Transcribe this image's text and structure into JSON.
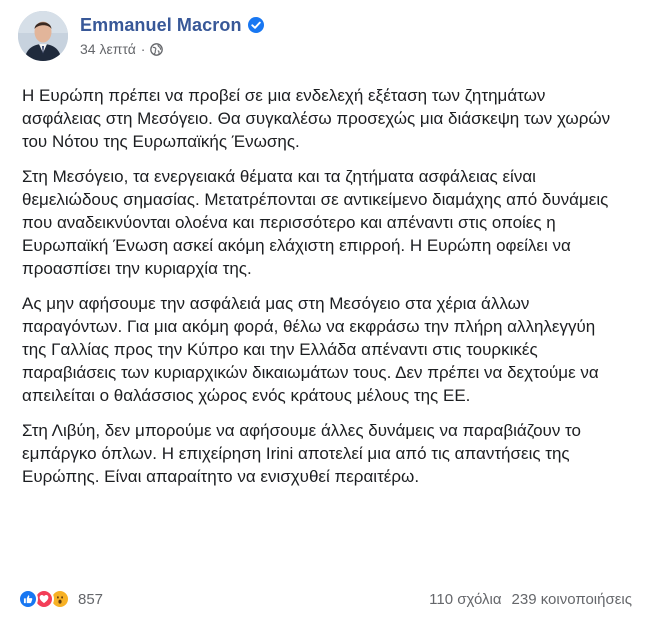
{
  "post": {
    "author": {
      "name": "Emmanuel Macron",
      "verified": true
    },
    "timestamp": "34 λεπτά",
    "separator": "·",
    "audience_icon": "globe-icon",
    "paragraphs": [
      "Η Ευρώπη πρέπει να προβεί σε μια ενδελεχή εξέταση των ζητημάτων ασφάλειας στη Μεσόγειο. Θα συγκαλέσω προσεχώς μια διάσκεψη των χωρών του Νότου της Ευρωπαϊκής Ένωσης.",
      "Στη Μεσόγειο, τα ενεργειακά θέματα και τα ζητήματα ασφάλειας είναι θεμελιώδους σημασίας. Μετατρέπονται σε αντικείμενο διαμάχης από δυνάμεις που αναδεικνύονται ολοένα και περισσότερο και απέναντι στις οποίες η Ευρωπαϊκή Ένωση ασκεί ακόμη ελάχιστη επιρροή. Η Ευρώπη οφείλει να προασπίσει την κυριαρχία της.",
      "Ας μην αφήσουμε την ασφάλειά μας στη Μεσόγειο στα χέρια άλλων παραγόντων. Για μια ακόμη φορά, θέλω να εκφράσω την πλήρη αλληλεγγύη της Γαλλίας προς την Κύπρο και την Ελλάδα απέναντι στις τουρκικές παραβιάσεις των κυριαρχικών δικαιωμάτων τους. Δεν πρέπει να δεχτούμε να απειλείται ο θαλάσσιος χώρος ενός κράτους μέλους της ΕΕ.",
      "Στη Λιβύη, δεν μπορούμε να αφήσουμε άλλες δυνάμεις να παραβιάζουν το εμπάργκο όπλων. Η επιχείρηση Irini αποτελεί μια από τις απαντήσεις της Ευρώπης. Είναι απαραίτητο να ενισχυθεί περαιτέρω."
    ],
    "reactions": {
      "icons": [
        "like-icon",
        "love-icon",
        "wow-icon"
      ],
      "count": "857"
    },
    "comments": "110 σχόλια",
    "shares": "239 κοινοποιήσεις"
  },
  "colors": {
    "author_name": "#385898",
    "meta_text": "#65676b",
    "verified_badge": "#1877f2",
    "like": "#1877f2",
    "love": "#f33e58",
    "wow": "#f7b125"
  }
}
